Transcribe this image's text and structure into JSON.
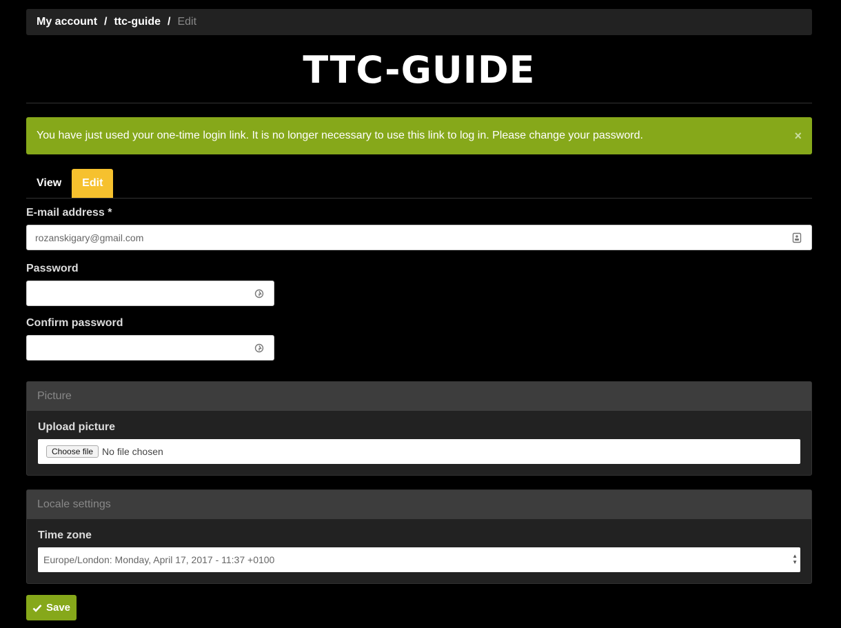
{
  "breadcrumb": {
    "items": [
      "My account",
      "ttc-guide"
    ],
    "current": "Edit",
    "separator": "/"
  },
  "site": {
    "title": "TTC-GUIDE"
  },
  "alert": {
    "message": "You have just used your one-time login link. It is no longer necessary to use this link to log in. Please change your password.",
    "close_icon": "×"
  },
  "tabs": [
    {
      "label": "View",
      "active": false
    },
    {
      "label": "Edit",
      "active": true
    }
  ],
  "form": {
    "email": {
      "label": "E-mail address",
      "required": "*",
      "value": "rozanskigary@gmail.com"
    },
    "password": {
      "label": "Password",
      "value": ""
    },
    "confirm_password": {
      "label": "Confirm password",
      "value": ""
    },
    "picture": {
      "panel_title": "Picture",
      "upload_label": "Upload picture",
      "button_label": "Choose file",
      "status": "No file chosen"
    },
    "locale": {
      "panel_title": "Locale settings",
      "timezone_label": "Time zone",
      "timezone_value": "Europe/London: Monday, April 17, 2017 - 11:37 +0100"
    },
    "save_label": "Save"
  },
  "colors": {
    "accent_green": "#86a81a",
    "tab_active": "#f6c12e",
    "panel_bg": "#222222",
    "panel_head": "#3d3d3d"
  }
}
